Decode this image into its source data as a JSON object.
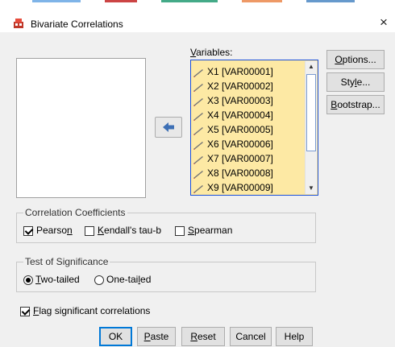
{
  "window": {
    "title": "Bivariate Correlations",
    "close_label": "×"
  },
  "variables": {
    "label_u": "V",
    "label_rest": "ariables:",
    "items": [
      "X1 [VAR00001]",
      "X2 [VAR00002]",
      "X3 [VAR00003]",
      "X4 [VAR00004]",
      "X5 [VAR00005]",
      "X6 [VAR00006]",
      "X7 [VAR00007]",
      "X8 [VAR00008]",
      "X9 [VAR00009]"
    ]
  },
  "side_buttons": {
    "options": {
      "u": "O",
      "rest": "ptions..."
    },
    "style": {
      "pre": "Sty",
      "u": "l",
      "post": "e..."
    },
    "bootstrap": {
      "u": "B",
      "rest": "ootstrap..."
    }
  },
  "coefficients": {
    "legend": "Correlation Coefficients",
    "pearson": {
      "pre": "Pearso",
      "u": "n",
      "checked": true
    },
    "kendall": {
      "u": "K",
      "rest": "endall's tau-b",
      "checked": false
    },
    "spearman": {
      "u": "S",
      "rest": "pearman",
      "checked": false
    }
  },
  "significance": {
    "legend": "Test of Significance",
    "two_tailed": {
      "u": "T",
      "rest": "wo-tailed",
      "checked": true
    },
    "one_tailed": {
      "pre": "One-tai",
      "u": "l",
      "post": "ed",
      "checked": false
    }
  },
  "flag": {
    "u": "F",
    "rest": "lag significant correlations",
    "checked": true
  },
  "bottom_buttons": {
    "ok": "OK",
    "paste": {
      "u": "P",
      "rest": "aste"
    },
    "reset": {
      "u": "R",
      "rest": "eset"
    },
    "cancel": "Cancel",
    "help": "Help"
  },
  "colors": {
    "variable_list_bg": "#fde9a4",
    "selection_border": "#1b4fd8",
    "dialog_bg": "#f0f0f0"
  }
}
